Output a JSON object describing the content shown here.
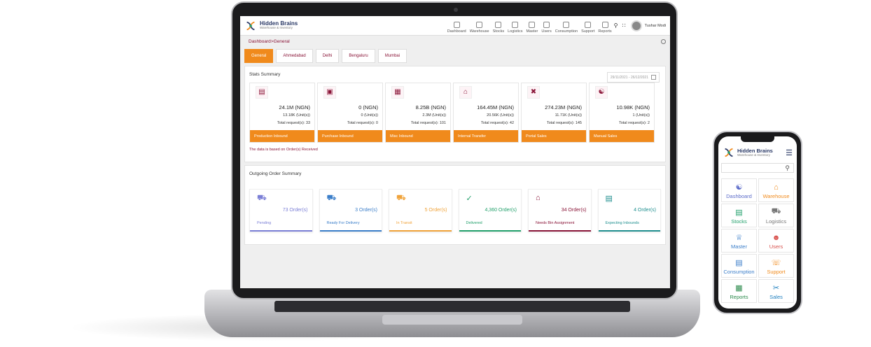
{
  "brand": {
    "name": "Hidden Brains",
    "tagline": "Warehouse & Inventory"
  },
  "nav": [
    "Dashboard",
    "Warehouse",
    "Stocks",
    "Logistics",
    "Master",
    "Users",
    "Consumption",
    "Support",
    "Reports"
  ],
  "user": {
    "name": "Tushar Modi"
  },
  "breadcrumb": {
    "parent": "Dashboard",
    "sep": " > ",
    "current": "General"
  },
  "tabs": [
    "General",
    "Ahmedabad",
    "Delhi",
    "Bengaluru",
    "Mumbai"
  ],
  "stats": {
    "title": "Stats Summary",
    "date_range": "29/11/2021 - 26/12/2021",
    "items": [
      {
        "value": "24.1M (NGN)",
        "units": "13.18K (Unit(s))",
        "requests": "Total request(s): 33",
        "label": "Production Inbound",
        "icon": "factory-icon"
      },
      {
        "value": "0 (NGN)",
        "units": "0 (Unit(s))",
        "requests": "Total request(s): 0",
        "label": "Purchase Inbound",
        "icon": "cart-icon"
      },
      {
        "value": "8.25B (NGN)",
        "units": "2.3M (Unit(s))",
        "requests": "Total request(s): 101",
        "label": "Misc Inbound",
        "icon": "box-icon"
      },
      {
        "value": "164.45M (NGN)",
        "units": "20.56K (Unit(s))",
        "requests": "Total request(s): 42",
        "label": "Internal Transfer",
        "icon": "warehouse-icon"
      },
      {
        "value": "274.23M (NGN)",
        "units": "11.71K (Unit(s))",
        "requests": "Total request(s): 145",
        "label": "Portal Sales",
        "icon": "tools-icon"
      },
      {
        "value": "10.98K (NGN)",
        "units": "1 (Unit(s))",
        "requests": "Total request(s): 2",
        "label": "Manual Sales",
        "icon": "handshake-icon"
      }
    ],
    "note": "The data is based on Order(s) Received"
  },
  "outgoing": {
    "title": "Outgoing Order Summary",
    "items": [
      {
        "value": "73 Order(s)",
        "label": "Pending",
        "color": "#7b7fd6"
      },
      {
        "value": "3 Order(s)",
        "label": "Ready For Delivery",
        "color": "#3b7ec9"
      },
      {
        "value": "5 Order(s)",
        "label": "In Transit",
        "color": "#f0a33a"
      },
      {
        "value": "4,360 Order(s)",
        "label": "Delivered",
        "color": "#22a06b"
      },
      {
        "value": "34 Order(s)",
        "label": "Needs Bin Assignment",
        "color": "#8a1538"
      },
      {
        "value": "4 Order(s)",
        "label": "Expecting Inbounds",
        "color": "#1f8f8f"
      }
    ]
  },
  "mobile": {
    "items": [
      {
        "label": "Dashboard",
        "color": "#5b6bc9"
      },
      {
        "label": "Warehouse",
        "color": "#f08a1c"
      },
      {
        "label": "Stocks",
        "color": "#22a06b"
      },
      {
        "label": "Logistics",
        "color": "#777777"
      },
      {
        "label": "Master",
        "color": "#3b7ec9"
      },
      {
        "label": "Users",
        "color": "#d9534f"
      },
      {
        "label": "Consumption",
        "color": "#3b7ec9"
      },
      {
        "label": "Support",
        "color": "#f08a1c"
      },
      {
        "label": "Reports",
        "color": "#2b8a4b"
      },
      {
        "label": "Sales",
        "color": "#1f7fbf"
      }
    ]
  }
}
